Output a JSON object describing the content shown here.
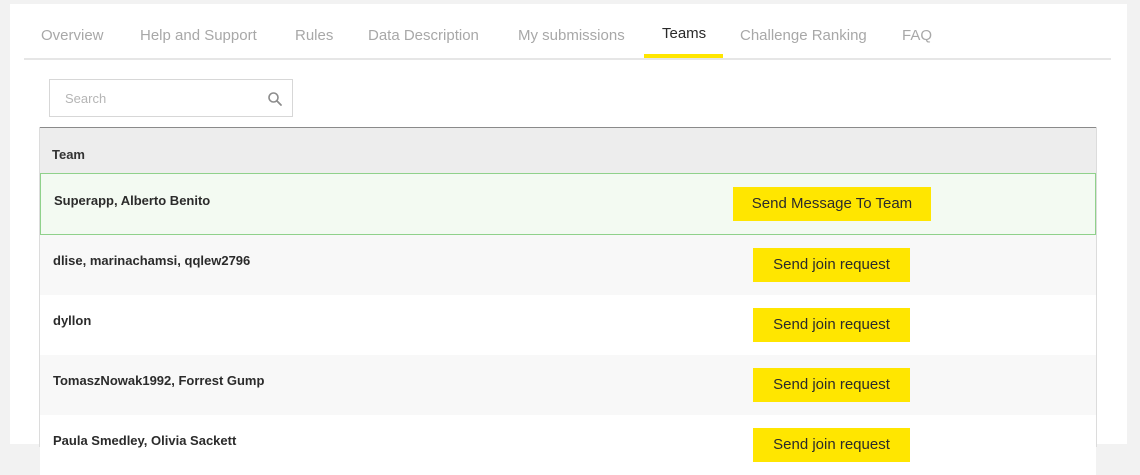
{
  "tabs": [
    {
      "label": "Overview"
    },
    {
      "label": "Help and Support"
    },
    {
      "label": "Rules"
    },
    {
      "label": "Data Description"
    },
    {
      "label": "My submissions"
    },
    {
      "label": "Teams"
    },
    {
      "label": "Challenge Ranking"
    },
    {
      "label": "FAQ"
    }
  ],
  "active_tab": "Teams",
  "search": {
    "placeholder": "Search",
    "icon": "search-icon"
  },
  "table": {
    "header": "Team",
    "rows": [
      {
        "name": "Superapp, Alberto Benito",
        "action": "Send Message To Team"
      },
      {
        "name": "dlise, marinachamsi, qqlew2796",
        "action": "Send join request"
      },
      {
        "name": "dyllon",
        "action": "Send join request"
      },
      {
        "name": "TomaszNowak1992, Forrest Gump",
        "action": "Send join request"
      },
      {
        "name": "Paula Smedley, Olivia Sackett",
        "action": "Send join request"
      }
    ]
  },
  "colors": {
    "accent": "#ffe600",
    "highlight_border": "#8fd18b",
    "highlight_bg": "#f3faf2"
  }
}
